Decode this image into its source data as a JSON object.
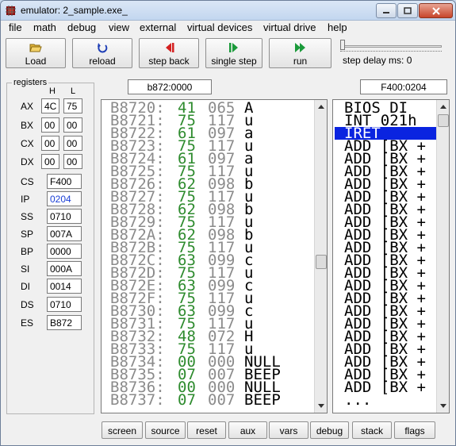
{
  "window": {
    "title": "emulator: 2_sample.exe_"
  },
  "menu": [
    "file",
    "math",
    "debug",
    "view",
    "external",
    "virtual devices",
    "virtual drive",
    "help"
  ],
  "toolbar": {
    "load": "Load",
    "reload": "reload",
    "step_back": "step back",
    "single_step": "single step",
    "run": "run",
    "step_delay": "step delay ms: 0"
  },
  "registers": {
    "legend": "registers",
    "h_label": "H",
    "l_label": "L",
    "split": [
      {
        "name": "AX",
        "h": "4C",
        "l": "75"
      },
      {
        "name": "BX",
        "h": "00",
        "l": "00"
      },
      {
        "name": "CX",
        "h": "00",
        "l": "00"
      },
      {
        "name": "DX",
        "h": "00",
        "l": "00"
      }
    ],
    "full": [
      {
        "name": "CS",
        "value": "F400"
      },
      {
        "name": "IP",
        "value": "0204"
      },
      {
        "name": "SS",
        "value": "0710"
      },
      {
        "name": "SP",
        "value": "007A"
      },
      {
        "name": "BP",
        "value": "0000"
      },
      {
        "name": "SI",
        "value": "000A"
      },
      {
        "name": "DI",
        "value": "0014"
      },
      {
        "name": "DS",
        "value": "0710"
      },
      {
        "name": "ES",
        "value": "B872"
      }
    ]
  },
  "memory_address": "b872:0000",
  "code_address": "F400:0204",
  "memory": [
    {
      "addr": "B8720:",
      "hex": "41",
      "dec": "065",
      "chr": "A"
    },
    {
      "addr": "B8721:",
      "hex": "75",
      "dec": "117",
      "chr": "u"
    },
    {
      "addr": "B8722:",
      "hex": "61",
      "dec": "097",
      "chr": "a"
    },
    {
      "addr": "B8723:",
      "hex": "75",
      "dec": "117",
      "chr": "u"
    },
    {
      "addr": "B8724:",
      "hex": "61",
      "dec": "097",
      "chr": "a"
    },
    {
      "addr": "B8725:",
      "hex": "75",
      "dec": "117",
      "chr": "u"
    },
    {
      "addr": "B8726:",
      "hex": "62",
      "dec": "098",
      "chr": "b"
    },
    {
      "addr": "B8727:",
      "hex": "75",
      "dec": "117",
      "chr": "u"
    },
    {
      "addr": "B8728:",
      "hex": "62",
      "dec": "098",
      "chr": "b"
    },
    {
      "addr": "B8729:",
      "hex": "75",
      "dec": "117",
      "chr": "u"
    },
    {
      "addr": "B872A:",
      "hex": "62",
      "dec": "098",
      "chr": "b"
    },
    {
      "addr": "B872B:",
      "hex": "75",
      "dec": "117",
      "chr": "u"
    },
    {
      "addr": "B872C:",
      "hex": "63",
      "dec": "099",
      "chr": "c"
    },
    {
      "addr": "B872D:",
      "hex": "75",
      "dec": "117",
      "chr": "u"
    },
    {
      "addr": "B872E:",
      "hex": "63",
      "dec": "099",
      "chr": "c"
    },
    {
      "addr": "B872F:",
      "hex": "75",
      "dec": "117",
      "chr": "u"
    },
    {
      "addr": "B8730:",
      "hex": "63",
      "dec": "099",
      "chr": "c"
    },
    {
      "addr": "B8731:",
      "hex": "75",
      "dec": "117",
      "chr": "u"
    },
    {
      "addr": "B8732:",
      "hex": "48",
      "dec": "072",
      "chr": "H"
    },
    {
      "addr": "B8733:",
      "hex": "75",
      "dec": "117",
      "chr": "u"
    },
    {
      "addr": "B8734:",
      "hex": "00",
      "dec": "000",
      "chr": "NULL"
    },
    {
      "addr": "B8735:",
      "hex": "07",
      "dec": "007",
      "chr": "BEEP"
    },
    {
      "addr": "B8736:",
      "hex": "00",
      "dec": "000",
      "chr": "NULL"
    },
    {
      "addr": "B8737:",
      "hex": "07",
      "dec": "007",
      "chr": "BEEP"
    }
  ],
  "disassembly": [
    "BIOS DI",
    "INT 021h",
    "IRET",
    "ADD [BX +",
    "ADD [BX +",
    "ADD [BX +",
    "ADD [BX +",
    "ADD [BX +",
    "ADD [BX +",
    "ADD [BX +",
    "ADD [BX +",
    "ADD [BX +",
    "ADD [BX +",
    "ADD [BX +",
    "ADD [BX +",
    "ADD [BX +",
    "ADD [BX +",
    "ADD [BX +",
    "ADD [BX +",
    "ADD [BX +",
    "ADD [BX +",
    "ADD [BX +",
    "ADD [BX +",
    "..."
  ],
  "selected_instruction_index": 2,
  "bottom_buttons": [
    "screen",
    "source",
    "reset",
    "aux",
    "vars",
    "debug",
    "stack",
    "flags"
  ],
  "colors": {
    "hex_green": "#2e8b2e",
    "selection_blue": "#0a24e0",
    "ip_blue": "#1a3fd6"
  }
}
